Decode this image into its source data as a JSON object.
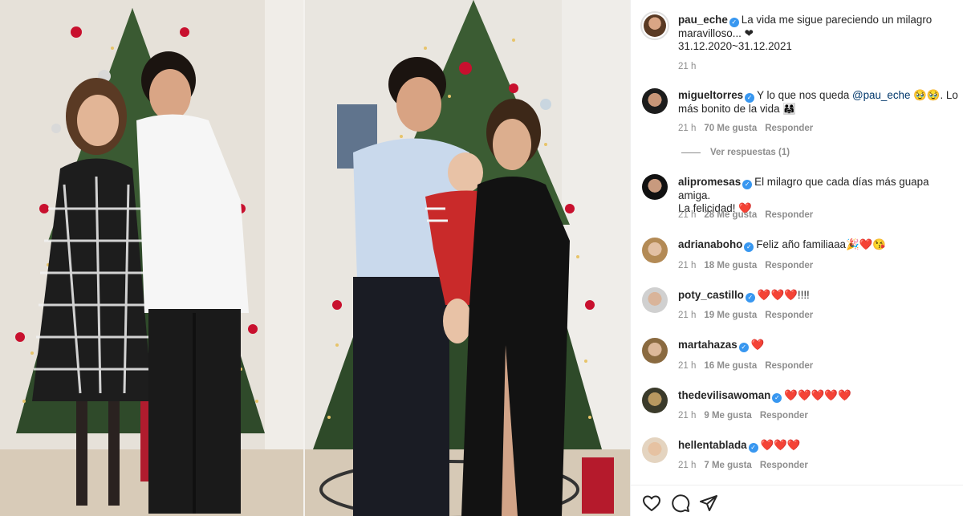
{
  "post": {
    "author": "pau_eche",
    "caption_line1": "La vida me sigue pareciendo un milagro",
    "caption_line2": "maravilloso... ❤",
    "caption_line3": "31.12.2020~31.12.2021",
    "time": "21 h"
  },
  "comments": [
    {
      "user": "migueltorres",
      "text_a": "Y lo que nos queda ",
      "mention": "@pau_eche",
      "text_b": " 🥹🥹. Lo",
      "text_line2": "más bonito de la vida 👨‍👩‍👧",
      "time": "21 h",
      "likes": "70 Me gusta",
      "reply": "Responder",
      "view_replies": "Ver respuestas (1)"
    },
    {
      "user": "alipromesas",
      "text": "El milagro que cada días más guapa amiga.",
      "text_line2": "La felicidad! ❤️",
      "time": "21 h",
      "likes": "28 Me gusta",
      "reply": "Responder"
    },
    {
      "user": "adrianaboho",
      "text": "Feliz año familiaaa🎉❤️😘",
      "time": "21 h",
      "likes": "18 Me gusta",
      "reply": "Responder"
    },
    {
      "user": "poty_castillo",
      "text": "❤️❤️❤️!!!!",
      "time": "21 h",
      "likes": "19 Me gusta",
      "reply": "Responder"
    },
    {
      "user": "martahazas",
      "text": "❤️",
      "time": "21 h",
      "likes": "16 Me gusta",
      "reply": "Responder"
    },
    {
      "user": "thedevilisawoman",
      "text": "❤️❤️❤️❤️❤️",
      "time": "21 h",
      "likes": "9 Me gusta",
      "reply": "Responder"
    },
    {
      "user": "hellentablada",
      "text": "❤️❤️❤️",
      "time": "21 h",
      "likes": "7 Me gusta",
      "reply": "Responder"
    }
  ],
  "icons": [
    "heart-icon",
    "comment-icon",
    "share-icon"
  ],
  "colors": {
    "verified": "#3897f0",
    "meta": "#8e8e8e",
    "mention": "#00376b",
    "tree": "#2f4a2a",
    "accent_red": "#c8102e"
  }
}
